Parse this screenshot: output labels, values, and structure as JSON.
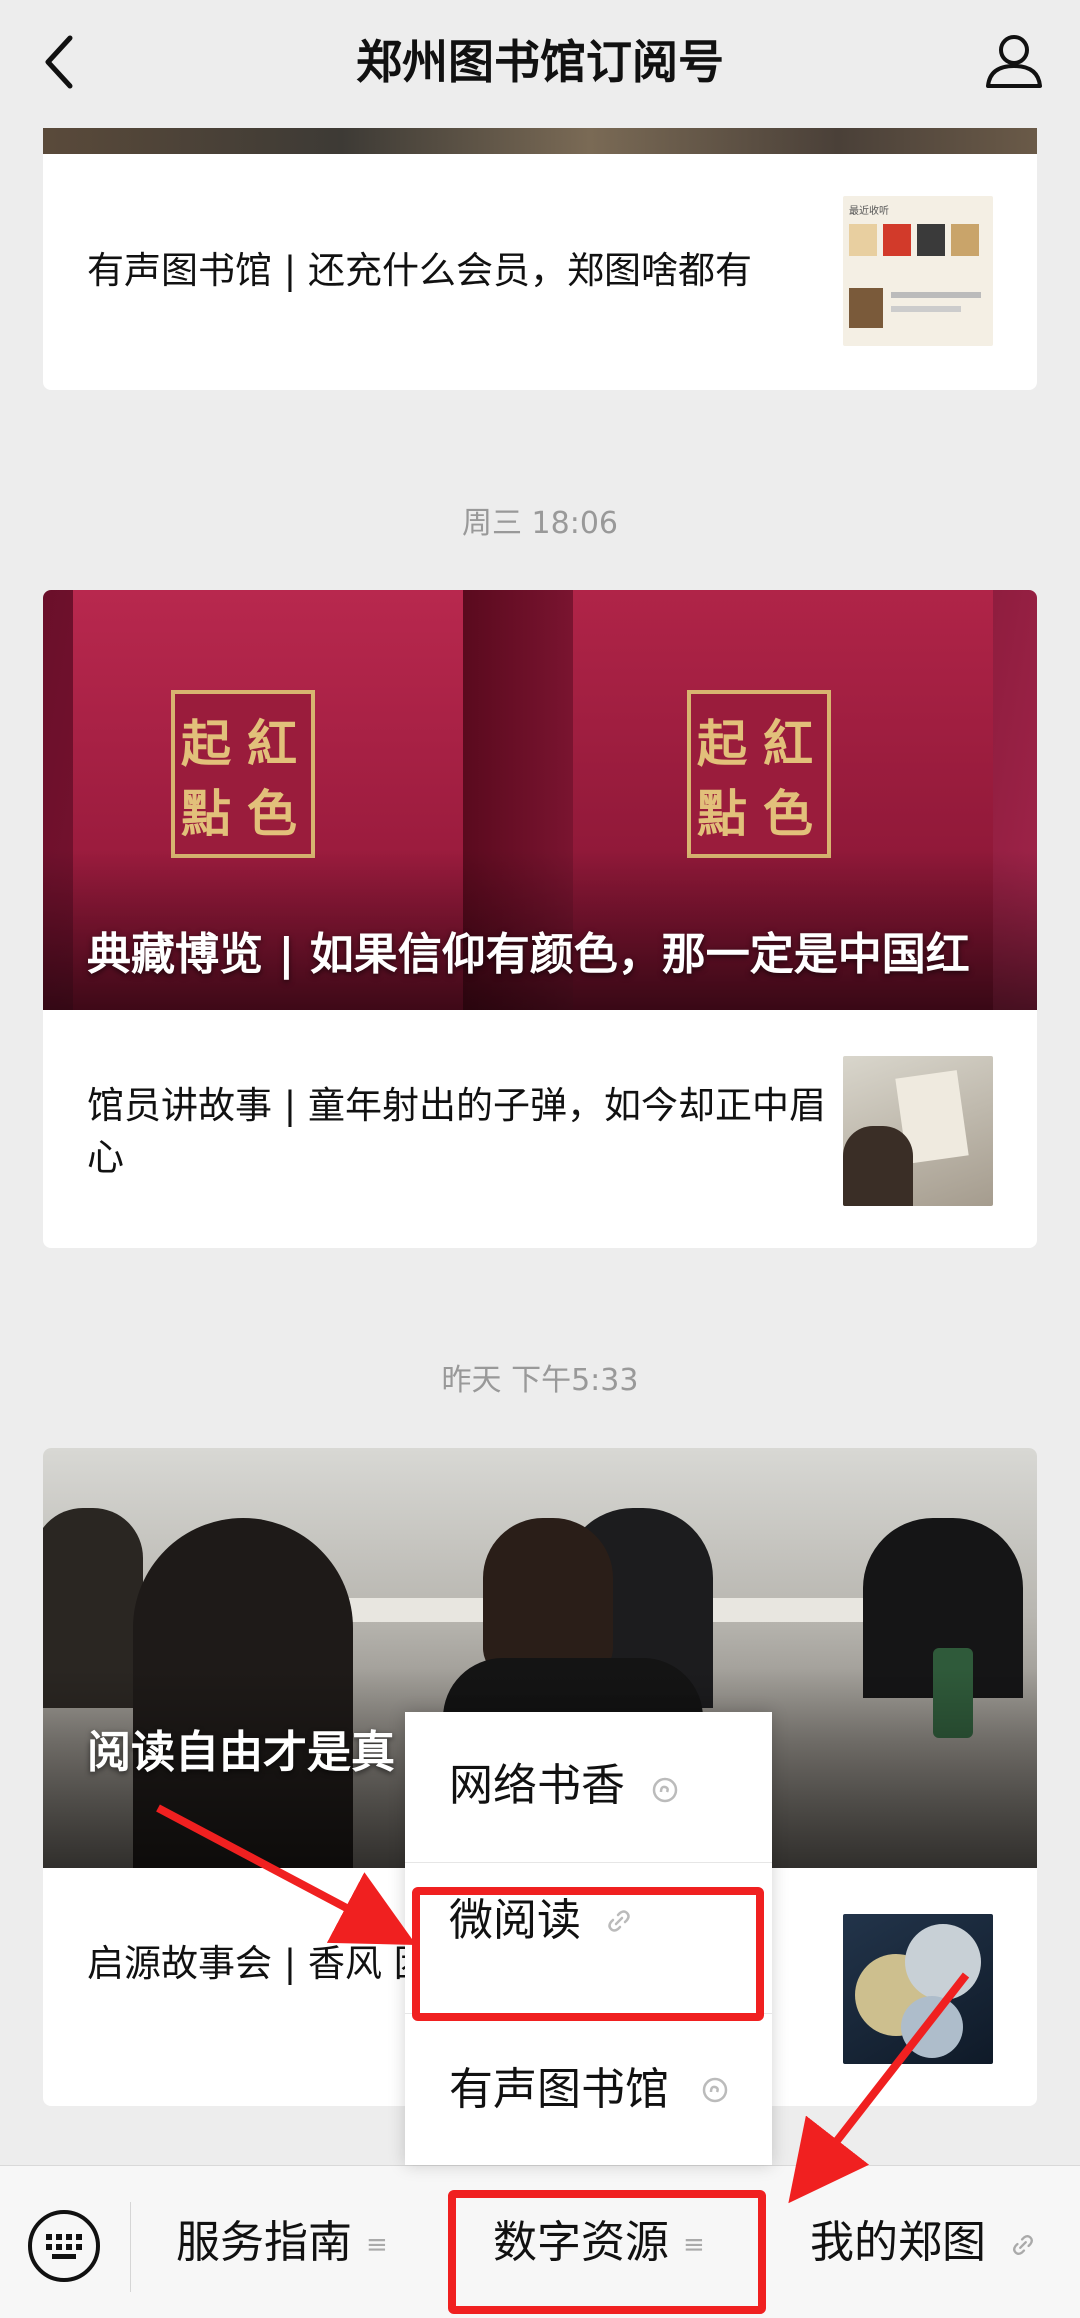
{
  "header": {
    "title": "郑州图书馆订阅号",
    "back_icon": "chevron-left-icon",
    "profile_icon": "person-icon"
  },
  "articles": [
    {
      "title": "有声图书馆 | 还充什么会员，郑图啥都有",
      "thumb_caption": "最近收听"
    },
    {
      "timestamp": "周三 18:06",
      "hero_title": "典藏博览 | 如果信仰有颜色，那一定是中国红",
      "book_seal": [
        "起",
        "點",
        "紅",
        "色"
      ],
      "sub_title": "馆员讲故事 | 童年射出的子弹，如今却正中眉心"
    },
    {
      "timestamp": "昨天 下午5:33",
      "hero_title": "阅读自由才是真  你选我订”来了",
      "sub_title": "启源故事会 | 香风  团扇"
    }
  ],
  "menubar": {
    "keyboard_icon": "keyboard-icon",
    "items": [
      {
        "label": "服务指南",
        "mark": "≡"
      },
      {
        "label": "数字资源",
        "mark": "≡"
      },
      {
        "label": "我的郑图",
        "mark": "link"
      }
    ]
  },
  "popup": {
    "items": [
      {
        "label": "网络书香"
      },
      {
        "label": "微阅读"
      },
      {
        "label": "有声图书馆"
      }
    ]
  },
  "colors": {
    "background": "#ededed",
    "annotation": "#f02020"
  }
}
